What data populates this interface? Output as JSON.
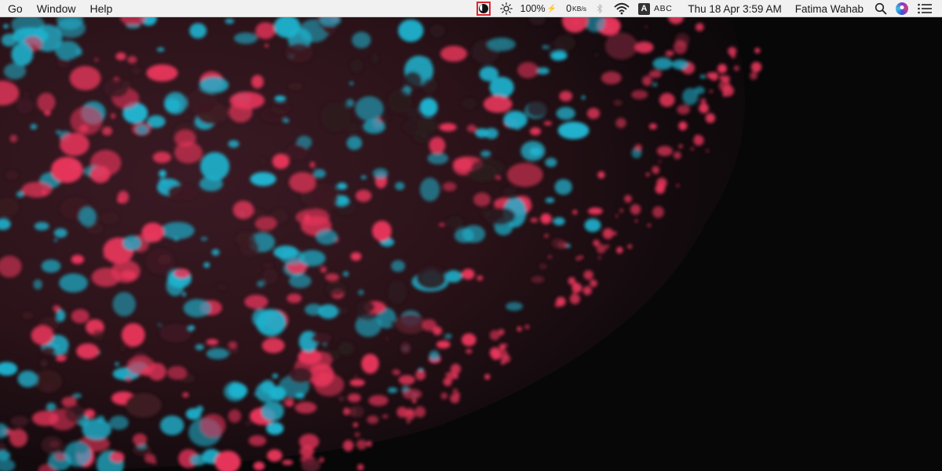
{
  "menubar": {
    "menus": [
      "Go",
      "Window",
      "Help"
    ],
    "status": {
      "night_shift_icon": "night-shift-icon",
      "brightness_icon": "brightness-icon",
      "battery_text": "100%",
      "charging_glyph": "⚡",
      "network_speed": "0",
      "network_unit": "KB/s",
      "bluetooth_icon": "bluetooth-icon",
      "wifi_icon": "wifi-icon",
      "input_source_badge": "A",
      "input_source_label": "ABC",
      "clock": "Thu 18 Apr  3:59 AM",
      "user_name": "Fatima Wahab",
      "search_icon": "spotlight-search-icon",
      "siri_icon": "siri-icon",
      "notification_icon": "notification-center-icon"
    }
  },
  "colors": {
    "menubar_bg": "#f1f1f1",
    "highlight": "#d8282f",
    "wallpaper_red": "#e8365b",
    "wallpaper_cyan": "#1fb3cf",
    "wallpaper_dark": "#070708"
  }
}
